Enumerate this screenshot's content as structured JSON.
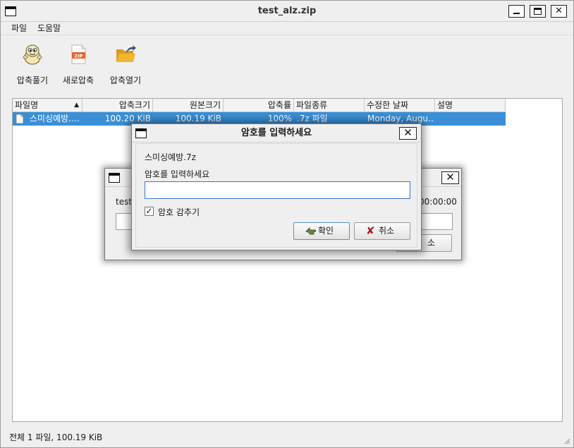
{
  "window": {
    "title": "test_alz.zip"
  },
  "menu": {
    "file": "파일",
    "help": "도움말"
  },
  "toolbar": {
    "extract": "압축풀기",
    "new_archive": "새로압축",
    "open_archive": "압축열기"
  },
  "columns": [
    "파일명",
    "압축크기",
    "원본크기",
    "압축률",
    "파일종류",
    "수정한 날짜",
    "설명"
  ],
  "rows": [
    {
      "name": "스미싱예방.…",
      "compressed": "100.20 KiB",
      "original": "100.19 KiB",
      "ratio": "100%",
      "type": ".7z 파일",
      "modified": "Monday, Augu…",
      "description": ""
    }
  ],
  "status": "전체 1 파일, 100.19 KiB",
  "progress_dialog": {
    "file_prefix": "test",
    "time": "00:00:00",
    "cancel_partial": "소"
  },
  "password_dialog": {
    "title": "암호를 입력하세요",
    "filename": "스미싱예방.7z",
    "prompt": "암호를 입력하세요",
    "password_value": "",
    "hide_label": "암호 감추기",
    "hide_checked": true,
    "ok": "확인",
    "cancel": "취소"
  },
  "icons": {
    "window": "window-icon",
    "minimize": "minimize-icon",
    "maximize": "maximize-icon",
    "close": "close-icon",
    "extract": "mascot-icon",
    "new_archive": "zip-file-icon",
    "open_archive": "folder-open-icon",
    "file": "document-icon",
    "ok": "ok-hand-icon",
    "cancel": "x-mark-icon"
  },
  "colors": {
    "selection": "#3a8fd6",
    "zip_icon": "#e8652a",
    "folder": "#f0b632"
  }
}
